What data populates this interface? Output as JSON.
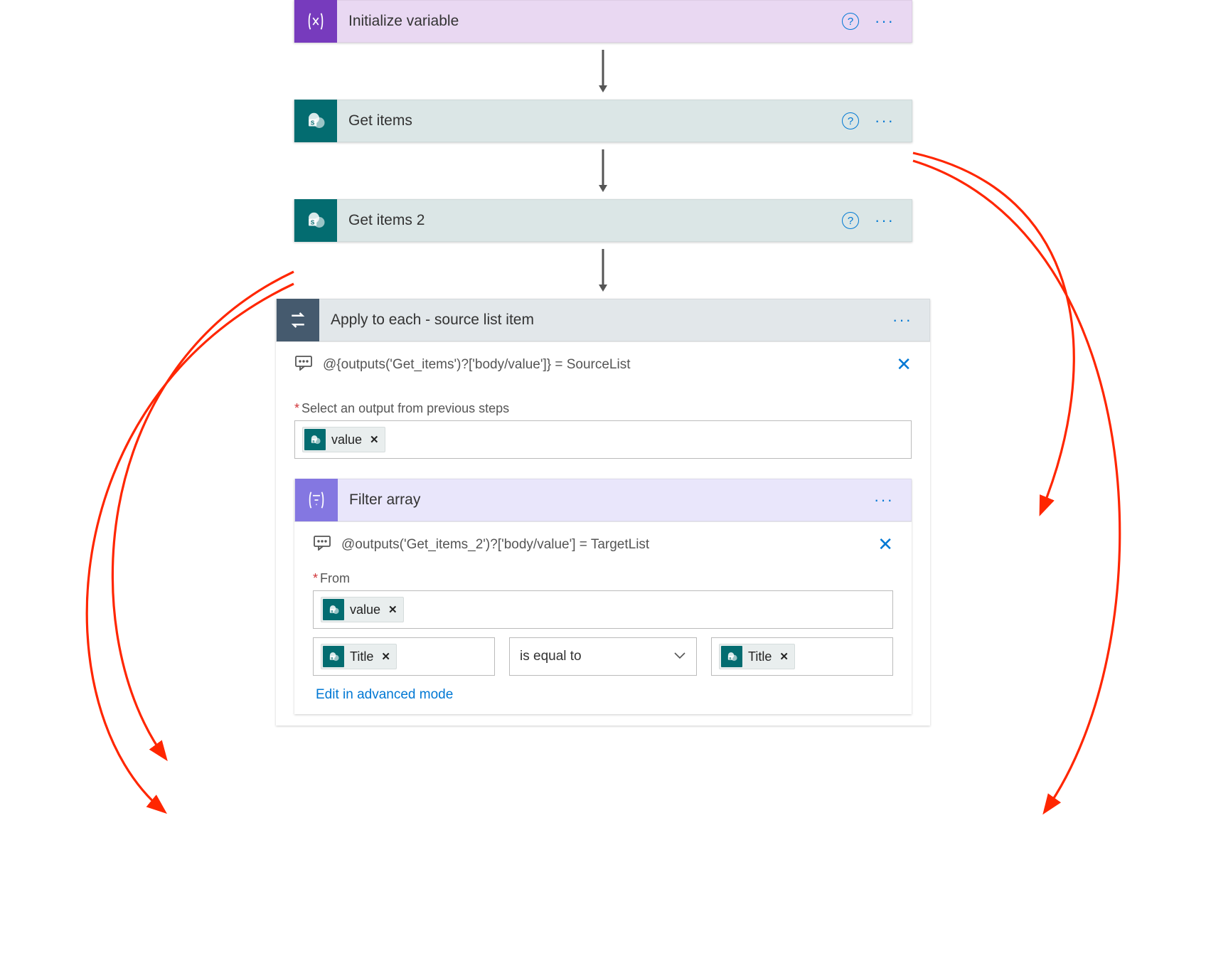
{
  "steps": {
    "initialize_variable": {
      "title": "Initialize variable"
    },
    "get_items": {
      "title": "Get items"
    },
    "get_items_2": {
      "title": "Get items 2"
    },
    "apply_to_each": {
      "title": "Apply to each - source list item",
      "comment": "@{outputs('Get_items')?['body/value']} = SourceList",
      "select_label": "Select an output from previous steps",
      "token": "value"
    },
    "filter_array": {
      "title": "Filter array",
      "comment": "@outputs('Get_items_2')?['body/value'] = TargetList",
      "from_label": "From",
      "from_token": "value",
      "cond_left": "Title",
      "cond_op": "is equal to",
      "cond_right": "Title",
      "advanced_link": "Edit in advanced mode"
    }
  }
}
